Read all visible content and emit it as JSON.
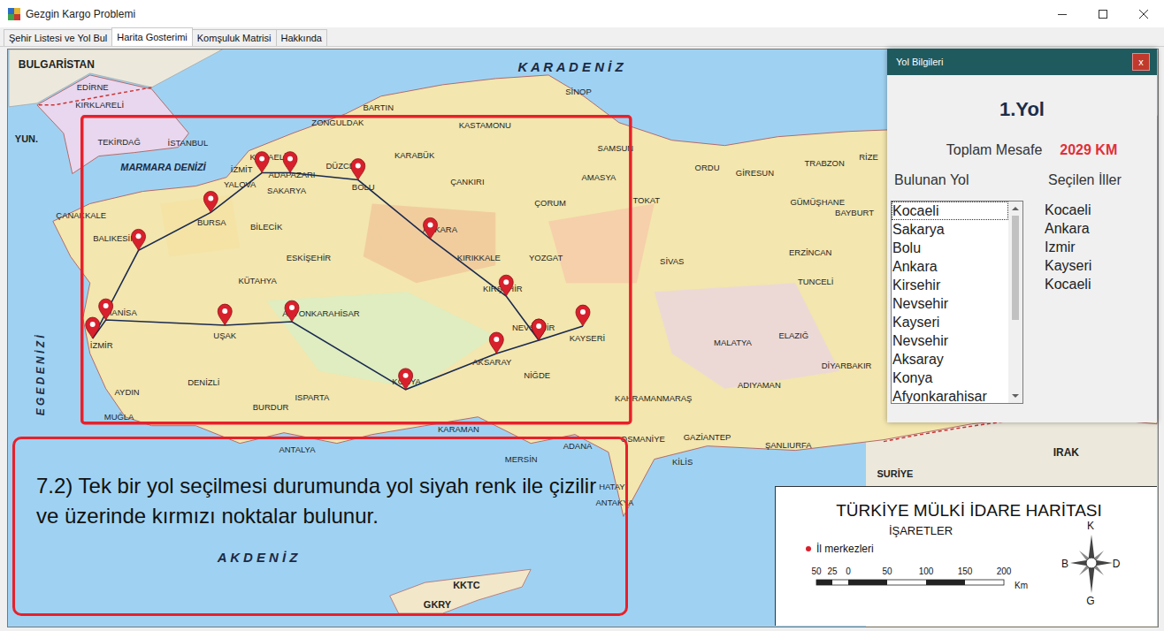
{
  "window": {
    "title": "Gezgin Kargo Problemi"
  },
  "tabs": [
    {
      "label": "Şehir Listesi ve Yol Bul",
      "selected": false
    },
    {
      "label": "Harita Gosterimi",
      "selected": true
    },
    {
      "label": "Komşuluk Matrisi",
      "selected": false
    },
    {
      "label": "Hakkında",
      "selected": false
    }
  ],
  "map": {
    "regions": [
      "BULGARİSTAN",
      "K A R A D E N İ Z",
      "YUN.",
      "MARMARA DENİZİ",
      "E G E   D E N İ Z İ",
      "A K D E N İ Z",
      "KKTC",
      "GKRY",
      "SURİYE",
      "IRAK"
    ],
    "cities": [
      "EDİRNE",
      "KIRKLARELİ",
      "TEKİRDAĞ",
      "İSTANBUL",
      "KOCAELİ",
      "İZMİT",
      "YALOVA",
      "ADAPAZARI",
      "SAKARYA",
      "DÜZCE",
      "BOLU",
      "BARTIN",
      "ZONGULDAK",
      "KARABÜK",
      "KASTAMONU",
      "SİNOP",
      "SAMSUN",
      "ÇANKIRI",
      "AMASYA",
      "ÇORUM",
      "TOKAT",
      "ORDU",
      "GİRESUN",
      "TRABZON",
      "RİZE",
      "GÜMÜŞHANE",
      "BAYBURT",
      "ERZİNCAN",
      "TUNCELİ",
      "SİVAS",
      "MALATYA",
      "ELAZIĞ",
      "DİYARBAKIR",
      "ÇANAKKALE",
      "BALIKESİR",
      "BURSA",
      "BİLECİK",
      "ESKİŞEHİR",
      "KÜTAHYA",
      "ANKARA",
      "KIRIKKALE",
      "YOZGAT",
      "KIRŞEHİR",
      "MANİSA",
      "İZMİR",
      "UŞAK",
      "AFYONKARAHİSAR",
      "NEVŞEHİR",
      "KAYSERİ",
      "AKSARAY",
      "NİĞDE",
      "KONYA",
      "AYDIN",
      "DENİZLİ",
      "BURDUR",
      "ISPARTA",
      "MUĞLA",
      "KARAMAN",
      "ANTALYA",
      "MERSİN",
      "ADANA",
      "OSMANİYE",
      "KAHRAMANMARAŞ",
      "ADIYAMAN",
      "GAZİANTEP",
      "ŞANLIURFA",
      "KİLİS",
      "HATAY",
      "ANTAKYA"
    ],
    "legend": {
      "title": "TÜRKİYE MÜLKİ İDARE HARİTASI",
      "subtitle": "İŞARETLER",
      "marker": "İl merkezleri",
      "scale": [
        "50",
        "25",
        "0",
        "50",
        "100",
        "150",
        "200"
      ],
      "unit": "Km",
      "compass": [
        "K",
        "B",
        "D",
        "G"
      ]
    }
  },
  "annotation": {
    "text": "7.2) Tek bir yol seçilmesi durumunda yol siyah renk ile çizilir ve üzerinde kırmızı noktalar bulunur."
  },
  "panel": {
    "title": "Yol Bilgileri",
    "close": "x",
    "route_title": "1.Yol",
    "distance_label": "Toplam Mesafe",
    "distance": "2029 KM",
    "found_label": "Bulunan Yol",
    "chosen_label": "Seçilen İller",
    "found": [
      {
        "name": "Kocaeli",
        "focused": true
      },
      {
        "name": "Sakarya",
        "focused": false
      },
      {
        "name": "Bolu",
        "focused": false
      },
      {
        "name": "Ankara",
        "focused": false
      },
      {
        "name": "Kirsehir",
        "focused": false
      },
      {
        "name": "Nevsehir",
        "focused": false
      },
      {
        "name": "Kayseri",
        "focused": false
      },
      {
        "name": "Nevsehir",
        "focused": false
      },
      {
        "name": "Aksaray",
        "focused": false
      },
      {
        "name": "Konya",
        "focused": false
      },
      {
        "name": "Afyonkarahisar",
        "focused": false
      }
    ],
    "scrollbar": {
      "level": 0.6
    },
    "chosen": [
      "Kocaeli",
      "Ankara",
      "Izmir",
      "Kayseri",
      "Kocaeli"
    ]
  }
}
